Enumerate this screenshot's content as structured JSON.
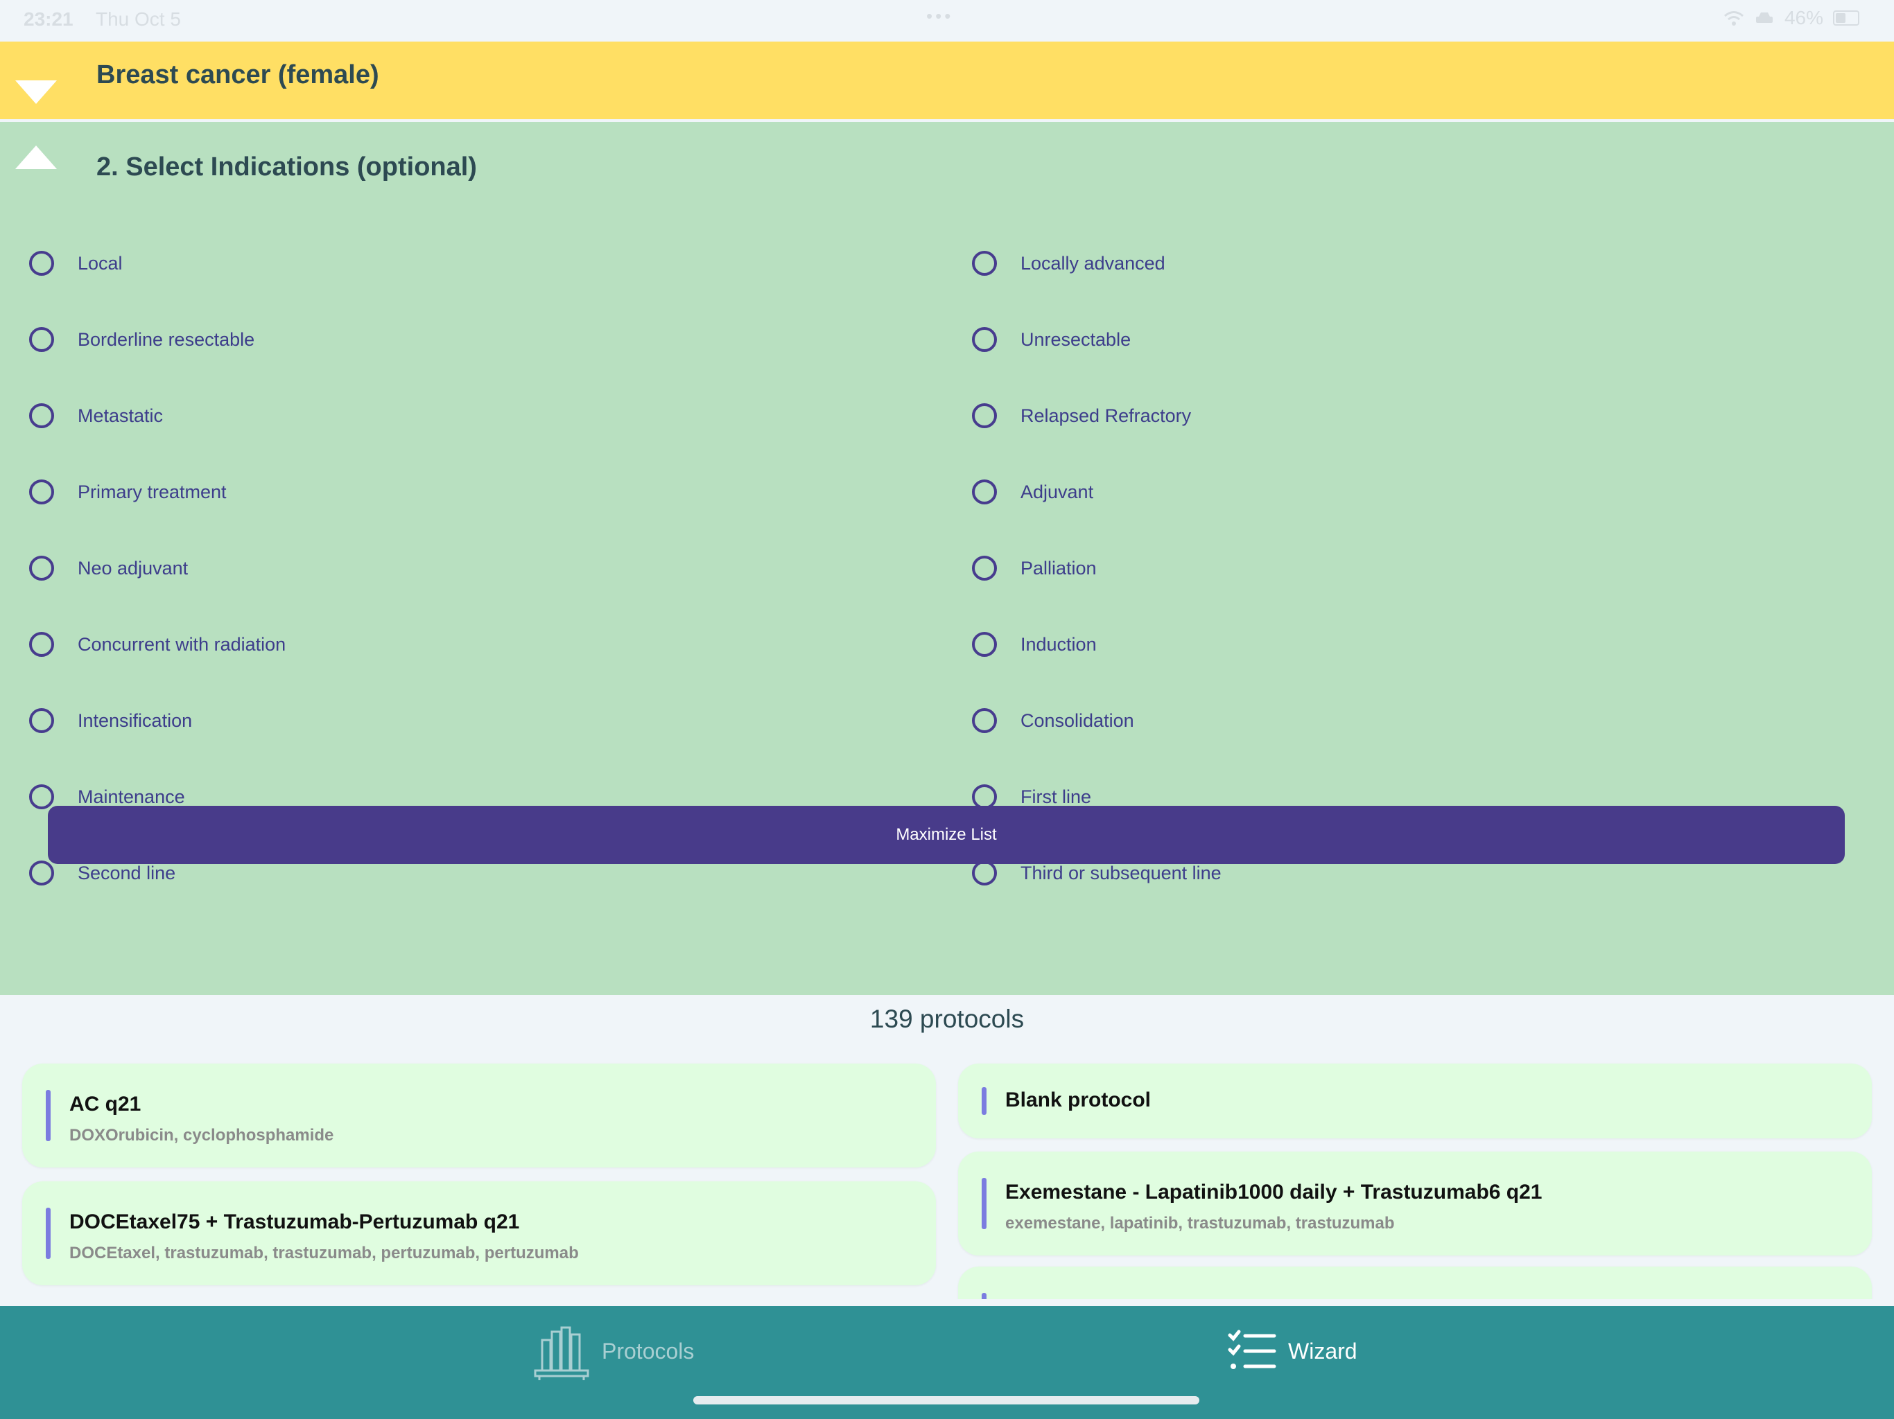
{
  "status_bar": {
    "time": "23:21",
    "date": "Thu Oct 5",
    "battery": "46%"
  },
  "header": {
    "title": "Breast cancer (female)"
  },
  "section": {
    "title": "2. Select Indications (optional)",
    "options_left": [
      "Local",
      "Borderline resectable",
      "Metastatic",
      "Primary treatment",
      "Neo adjuvant",
      "Concurrent with radiation",
      "Intensification",
      "Maintenance",
      "Second line"
    ],
    "options_right": [
      "Locally advanced",
      "Unresectable",
      "Relapsed  Refractory",
      "Adjuvant",
      "Palliation",
      "Induction",
      "Consolidation",
      "First line",
      "Third or subsequent line"
    ],
    "maximize_label": "Maximize List"
  },
  "protocols": {
    "count_label": "139 protocols",
    "cards_left": [
      {
        "title": "AC q21",
        "subtitle": "DOXOrubicin, cyclophosphamide"
      },
      {
        "title": "DOCEtaxel75 + Trastuzumab-Pertuzumab q21",
        "subtitle": "DOCEtaxel, trastuzumab, trastuzumab, pertuzumab, pertuzumab"
      }
    ],
    "cards_right": [
      {
        "title": "Blank protocol",
        "subtitle": ""
      },
      {
        "title": "Exemestane - Lapatinib1000 daily + Trastuzumab6 q21",
        "subtitle": "exemestane, lapatinib, trastuzumab, trastuzumab"
      }
    ]
  },
  "tabs": [
    {
      "label": "Protocols",
      "icon": "books-icon",
      "active": false
    },
    {
      "label": "Wizard",
      "icon": "checklist-icon",
      "active": true
    }
  ],
  "colors": {
    "header_bg": "#ffdf64",
    "section_bg": "#b8e0c0",
    "accent": "#483b8a",
    "card_bg": "#e0fde0",
    "tabbar_bg": "#2f9195"
  }
}
